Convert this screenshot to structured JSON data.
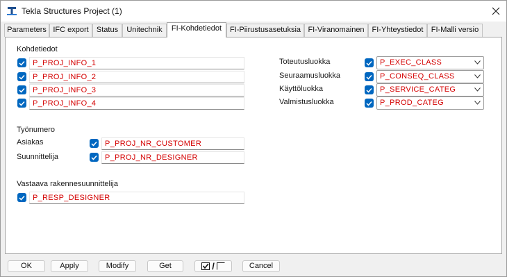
{
  "window": {
    "title": "Tekla Structures  Project (1)"
  },
  "tabs": [
    {
      "label": "Parameters"
    },
    {
      "label": "IFC export"
    },
    {
      "label": "Status"
    },
    {
      "label": "Unitechnik"
    },
    {
      "label": "FI-Kohdetiedot"
    },
    {
      "label": "FI-Piirustusasetuksia"
    },
    {
      "label": "FI-Viranomainen"
    },
    {
      "label": "FI-Yhteystiedot"
    },
    {
      "label": "FI-Malli versio"
    }
  ],
  "kohdetiedot": {
    "heading": "Kohdetiedot",
    "fields": [
      {
        "value": "P_PROJ_INFO_1",
        "checked": true
      },
      {
        "value": "P_PROJ_INFO_2",
        "checked": true
      },
      {
        "value": "P_PROJ_INFO_3",
        "checked": true
      },
      {
        "value": "P_PROJ_INFO_4",
        "checked": true
      }
    ]
  },
  "classes": [
    {
      "label": "Toteutusluokka",
      "value": "P_EXEC_CLASS",
      "checked": true
    },
    {
      "label": "Seuraamusluokka",
      "value": "P_CONSEQ_CLASS",
      "checked": true
    },
    {
      "label": "Käyttöluokka",
      "value": "P_SERVICE_CATEG",
      "checked": true
    },
    {
      "label": "Valmistusluokka",
      "value": "P_PROD_CATEG",
      "checked": true
    }
  ],
  "tyonumero": {
    "heading": "Työnumero",
    "rows": [
      {
        "label": "Asiakas",
        "value": "P_PROJ_NR_CUSTOMER",
        "checked": true
      },
      {
        "label": "Suunnittelija",
        "value": "P_PROJ_NR_DESIGNER",
        "checked": true
      }
    ]
  },
  "designer": {
    "heading": "Vastaava rakennesuunnittelija",
    "value": "P_RESP_DESIGNER",
    "checked": true
  },
  "buttons": {
    "ok": "OK",
    "apply": "Apply",
    "modify": "Modify",
    "get": "Get",
    "toggle": "/",
    "cancel": "Cancel"
  },
  "colors": {
    "accent": "#0067c0",
    "value_text": "#d40000"
  }
}
